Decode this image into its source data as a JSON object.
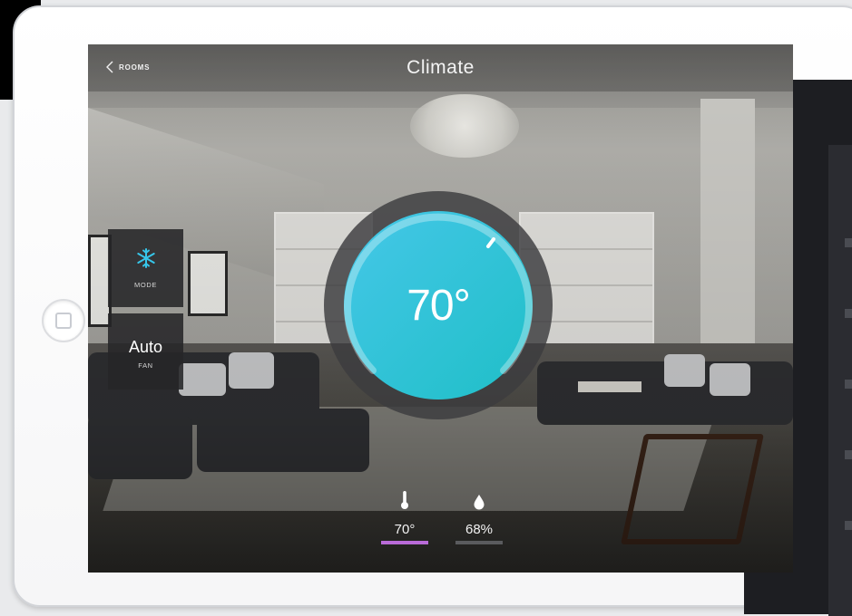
{
  "nav": {
    "back_label": "ROOMS",
    "title": "Climate"
  },
  "controls": {
    "mode": {
      "icon": "snowflake-icon",
      "label": "MODE"
    },
    "fan": {
      "value": "Auto",
      "label": "FAN"
    }
  },
  "thermostat": {
    "setpoint": "70°",
    "arc_colors": [
      "#45c7e8",
      "#2ec9c7"
    ]
  },
  "stats": {
    "temperature": {
      "icon": "thermometer-icon",
      "value": "70°",
      "accent": "#b96bd8"
    },
    "humidity": {
      "icon": "water-drop-icon",
      "value": "68%"
    }
  }
}
